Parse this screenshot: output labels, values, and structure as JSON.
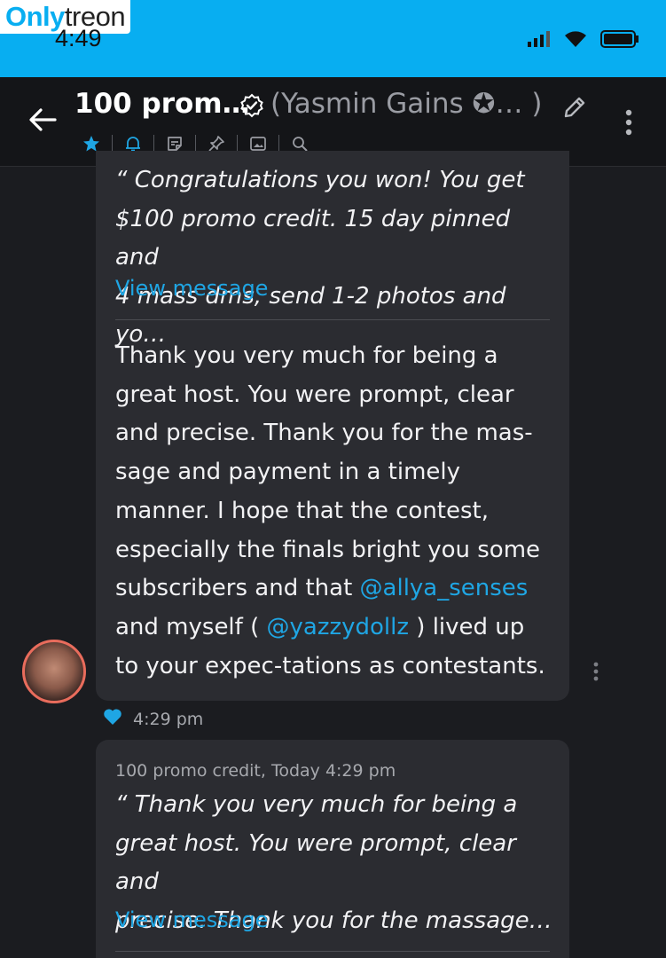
{
  "watermark": {
    "part1": "Only",
    "part2": "treon"
  },
  "status": {
    "time": "4:49"
  },
  "header": {
    "title": "100 prom…",
    "subtitle": "(Yasmin Gains ✪… )",
    "icons": [
      "back-arrow-icon",
      "verified-icon",
      "pencil-icon",
      "more-vert-icon"
    ]
  },
  "toolbar": {
    "icons": [
      "star-icon",
      "bell-icon",
      "sticker-icon",
      "pin-icon",
      "image-icon",
      "search-icon"
    ],
    "accent": "#1fa6e4"
  },
  "messages": {
    "first": {
      "quote_line1": "“ Congratulations you won! You get",
      "quote_line2": "$100 promo credit. 15 day pinned and",
      "quote_line3": "4 mass dms, send 1-2 photos and yo…",
      "view_label": "View message",
      "body_part1": "Thank you very much for being a great host. You were prompt, clear and precise. Thank you for the mas-sage and payment in a timely manner. I hope that the contest, especially the finals bright you some subscribers and that ",
      "mention1": "@allya_senses",
      "body_part2": " and myself ( ",
      "mention2": "@yazzydollz",
      "body_part3": " ) lived up to your expec-tations as contestants.",
      "time": "4:29 pm"
    },
    "second": {
      "meta": "100 promo credit, Today 4:29 pm",
      "quote_line1": "“ Thank you very much for being a",
      "quote_line2": "great host. You were prompt, clear and",
      "quote_line3": "precise. Thank you for the massage…",
      "view_label": "View message"
    }
  },
  "colors": {
    "brand": "#08aef1",
    "link": "#1fa6e4",
    "bubble": "#2b2c31",
    "background": "#1b1c20"
  }
}
